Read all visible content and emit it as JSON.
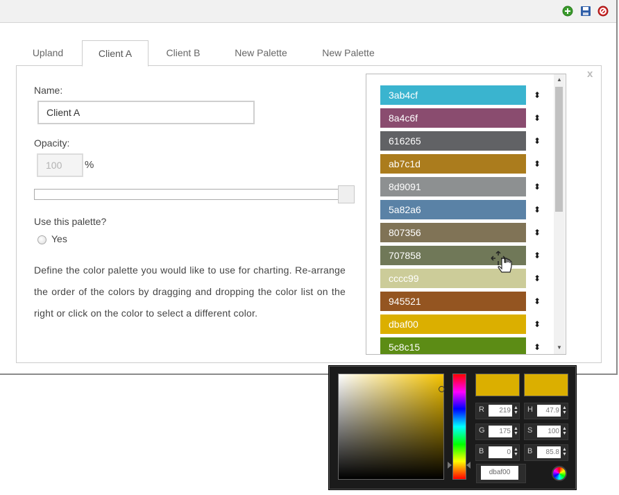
{
  "toolbar": {
    "add_icon": "add-circle-icon",
    "save_icon": "floppy-disk-icon",
    "cancel_icon": "cancel-circle-icon"
  },
  "tabs": [
    {
      "label": "Upland",
      "active": false
    },
    {
      "label": "Client A",
      "active": true
    },
    {
      "label": "Client B",
      "active": false
    },
    {
      "label": "New Palette",
      "active": false
    },
    {
      "label": "New Palette",
      "active": false
    }
  ],
  "panel": {
    "close_label": "x",
    "name_label": "Name:",
    "name_value": "Client A",
    "opacity_label": "Opacity:",
    "opacity_value": "100",
    "opacity_unit": "%",
    "opacity_level": 1.0,
    "use_label": "Use this palette?",
    "yes_label": "Yes",
    "description": "Define the color palette you would like to use for charting. Re-arrange the order of the colors by dragging and dropping the color list on the right or click on the color to select a different color."
  },
  "colors": [
    {
      "hex": "3ab4cf"
    },
    {
      "hex": "8a4c6f"
    },
    {
      "hex": "616265"
    },
    {
      "hex": "ab7c1d"
    },
    {
      "hex": "8d9091"
    },
    {
      "hex": "5a82a6"
    },
    {
      "hex": "807356"
    },
    {
      "hex": "707858"
    },
    {
      "hex": "cccc99"
    },
    {
      "hex": "945521"
    },
    {
      "hex": "dbaf00"
    },
    {
      "hex": "5c8c15"
    }
  ],
  "picker": {
    "r": "219",
    "g": "175",
    "b": "0",
    "h": "47.9",
    "s": "100",
    "bv": "85.8",
    "hex": "dbaf00",
    "labels": {
      "r": "R",
      "g": "G",
      "b": "B",
      "h": "H",
      "s": "S",
      "bv": "B"
    },
    "current_color": "#dbaf00"
  }
}
